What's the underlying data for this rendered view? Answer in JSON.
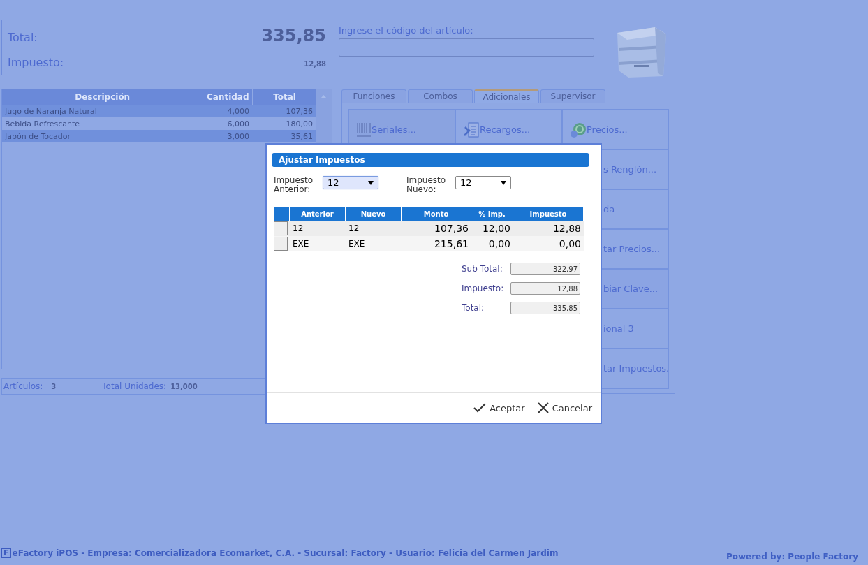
{
  "summary": {
    "total_label": "Total:",
    "total_value": "335,85",
    "tax_label": "Impuesto:",
    "tax_value": "12,88"
  },
  "items_table": {
    "columns": [
      "Descripción",
      "Cantidad",
      "Total"
    ],
    "rows": [
      [
        "Jugo de Naranja Natural",
        "4,000",
        "107,36"
      ],
      [
        "Bebida Refrescante",
        "6,000",
        "180,00"
      ],
      [
        "Jabón de Tocador",
        "3,000",
        "35,61"
      ]
    ]
  },
  "counts": {
    "articles_label": "Artículos:",
    "articles_value": "3",
    "units_label": "Total Unidades:",
    "units_value": "13,000"
  },
  "code_input": {
    "label": "Ingrese el código del artículo:"
  },
  "tabs": [
    {
      "label": "Funciones",
      "selected": false
    },
    {
      "label": "Combos",
      "selected": false
    },
    {
      "label": "Adicionales",
      "selected": true
    },
    {
      "label": "Supervisor",
      "selected": false
    }
  ],
  "function_buttons": [
    {
      "label": "Seriales...",
      "kind": "full"
    },
    {
      "label": "Recargos...",
      "kind": "full"
    },
    {
      "label": "Precios...",
      "kind": "full"
    },
    {
      "label": "s Renglón...",
      "kind": "clipped"
    },
    {
      "label": "da",
      "kind": "clipped"
    },
    {
      "label": "tar Precios...",
      "kind": "clipped"
    },
    {
      "label": "biar Clave...",
      "kind": "clipped"
    },
    {
      "label": "ional 3",
      "kind": "clipped"
    },
    {
      "label": "tar Impuestos.",
      "kind": "clipped"
    }
  ],
  "dialog": {
    "title": "Ajustar Impuestos",
    "selects": [
      {
        "label": "Impuesto Anterior:",
        "value": "12",
        "focused": true
      },
      {
        "label": "Impuesto Nuevo:",
        "value": "12",
        "focused": false
      }
    ],
    "columns": [
      "Anterior",
      "Nuevo",
      "Monto",
      "% Imp.",
      "Impuesto"
    ],
    "rows": [
      [
        "12",
        "12",
        "107,36",
        "12,00",
        "12,88"
      ],
      [
        "EXE",
        "EXE",
        "215,61",
        "0,00",
        "0,00"
      ]
    ],
    "totals": [
      {
        "label": "Sub Total:",
        "value": "322,97"
      },
      {
        "label": "Impuesto:",
        "value": "12,88"
      },
      {
        "label": "Total:",
        "value": "335,85"
      }
    ],
    "buttons": [
      "Aceptar",
      "Cancelar"
    ]
  },
  "status_bar": {
    "logo_letter": "F",
    "text": "eFactory iPOS - Empresa: Comercializadora Ecomarket, C.A. - Sucursal: Factory - Usuario: Felicia del Carmen Jardim",
    "powered_by": "Powered by: People Factory"
  }
}
